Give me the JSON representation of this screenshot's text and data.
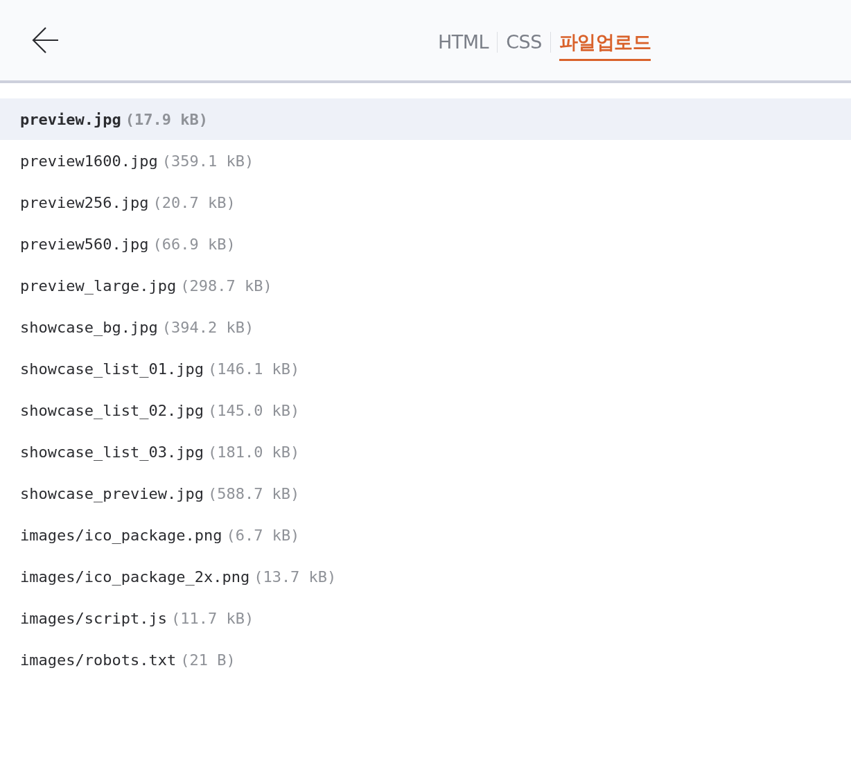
{
  "tabs": [
    {
      "label": "HTML",
      "selected": false
    },
    {
      "label": "CSS",
      "selected": false
    },
    {
      "label": "파일업로드",
      "selected": true
    }
  ],
  "files": [
    {
      "name": "preview.jpg",
      "size": "(17.9 kB)",
      "selected": true
    },
    {
      "name": "preview1600.jpg",
      "size": "(359.1 kB)",
      "selected": false
    },
    {
      "name": "preview256.jpg",
      "size": "(20.7 kB)",
      "selected": false
    },
    {
      "name": "preview560.jpg",
      "size": "(66.9 kB)",
      "selected": false
    },
    {
      "name": "preview_large.jpg",
      "size": "(298.7 kB)",
      "selected": false
    },
    {
      "name": "showcase_bg.jpg",
      "size": "(394.2 kB)",
      "selected": false
    },
    {
      "name": "showcase_list_01.jpg",
      "size": "(146.1 kB)",
      "selected": false
    },
    {
      "name": "showcase_list_02.jpg",
      "size": "(145.0 kB)",
      "selected": false
    },
    {
      "name": "showcase_list_03.jpg",
      "size": "(181.0 kB)",
      "selected": false
    },
    {
      "name": "showcase_preview.jpg",
      "size": "(588.7 kB)",
      "selected": false
    },
    {
      "name": "images/ico_package.png",
      "size": "(6.7 kB)",
      "selected": false
    },
    {
      "name": "images/ico_package_2x.png",
      "size": "(13.7 kB)",
      "selected": false
    },
    {
      "name": "images/script.js",
      "size": "(11.7 kB)",
      "selected": false
    },
    {
      "name": "images/robots.txt",
      "size": "(21 B)",
      "selected": false
    }
  ]
}
